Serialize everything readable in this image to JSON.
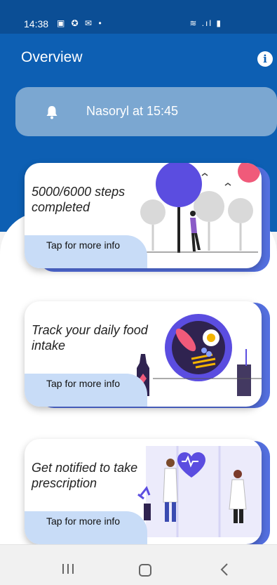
{
  "status_bar": {
    "time": "14:38",
    "left_icons": "▣ ✪ ✉ •",
    "right_icons": "≋ .ıl ▮"
  },
  "header": {
    "title": "Overview",
    "info_icon": "info-icon",
    "info_glyph": "i"
  },
  "reminder": {
    "icon": "bell-icon",
    "text": "Nasoryl at 15:45"
  },
  "cards": [
    {
      "title": "5000/6000 steps completed",
      "button_label": "Tap for more info",
      "illustration": "walking-person-park"
    },
    {
      "title": "Track your daily food intake",
      "button_label": "Tap for more info",
      "illustration": "food-plate"
    },
    {
      "title": "Get notified to take prescription",
      "button_label": "Tap for more info",
      "illustration": "doctors-heart"
    }
  ],
  "nav_bar": {
    "recents": "recents-icon",
    "home": "home-icon",
    "back": "back-icon"
  },
  "colors": {
    "header_blue": "#0d5fb3",
    "status_blue": "#0b4e95",
    "reminder_bg": "#7ba7d1",
    "card_accent": "#5470e0",
    "button_bg": "#c8dcf7",
    "illustration_purple": "#5b4de0",
    "illustration_pink": "#f05a7a"
  }
}
